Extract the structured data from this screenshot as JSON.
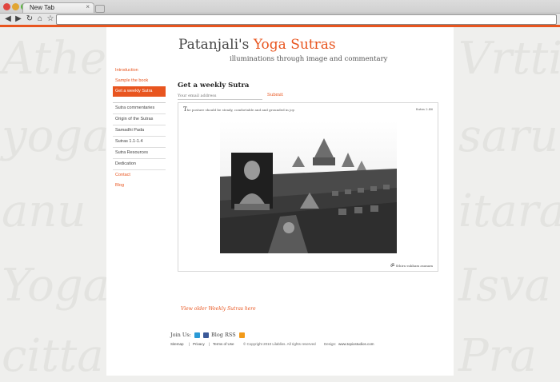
{
  "browser": {
    "tab_title": "New Tab",
    "tab_close": "×",
    "back_icon": "back-arrow-icon",
    "forward_icon": "forward-arrow-icon",
    "reload_icon": "reload-icon",
    "home_icon": "home-icon",
    "star_icon": "star-icon",
    "address_value": ""
  },
  "background_words": [
    "Athe",
    "yoga",
    "anu",
    "Yoga",
    "citta",
    "Vrtti",
    "saru",
    "itara",
    "Isva",
    "Pra"
  ],
  "header": {
    "title_main": "Patanjali's ",
    "title_accent": "Yoga Sutras",
    "subtitle": "illuminations through image and commentary"
  },
  "nav": {
    "group1": [
      "Introduction",
      "Sample the book",
      "Get a weekly Sutra"
    ],
    "group2": [
      "Sutra commentaries",
      "Origin of the Sutras",
      "Samadhi Pada",
      "Sutras 1.1-1.4",
      "Sutra Resources",
      "Dedication"
    ],
    "group3": [
      "Contact",
      "Blog"
    ]
  },
  "weekly": {
    "heading": "Get a weekly Sutra",
    "email_placeholder": "Your email address",
    "submit_label": "Submit"
  },
  "sutra": {
    "dropcap": "T",
    "quote_rest": "he posture should be steady, comfortable and and grounded in joy.",
    "reference": "Sutra 2.46",
    "sanskrit": "Sthira sukham asanam"
  },
  "older_link": "View older Weekly Sutras here",
  "social": {
    "join_label": "Join Us:",
    "blog_rss_label": "Blog RSS"
  },
  "footer": {
    "sitemap": "Sitemap",
    "sep": "|",
    "privacy": "Privacy",
    "terms": "Terms of Use",
    "copyright": "© Copyright 2010 Lilabliss. All rights reserved",
    "design_label": "Design:",
    "design_link": "www.topiostudios.com"
  },
  "colors": {
    "accent": "#e8551f",
    "background": "#efefed",
    "page": "#ffffff"
  }
}
